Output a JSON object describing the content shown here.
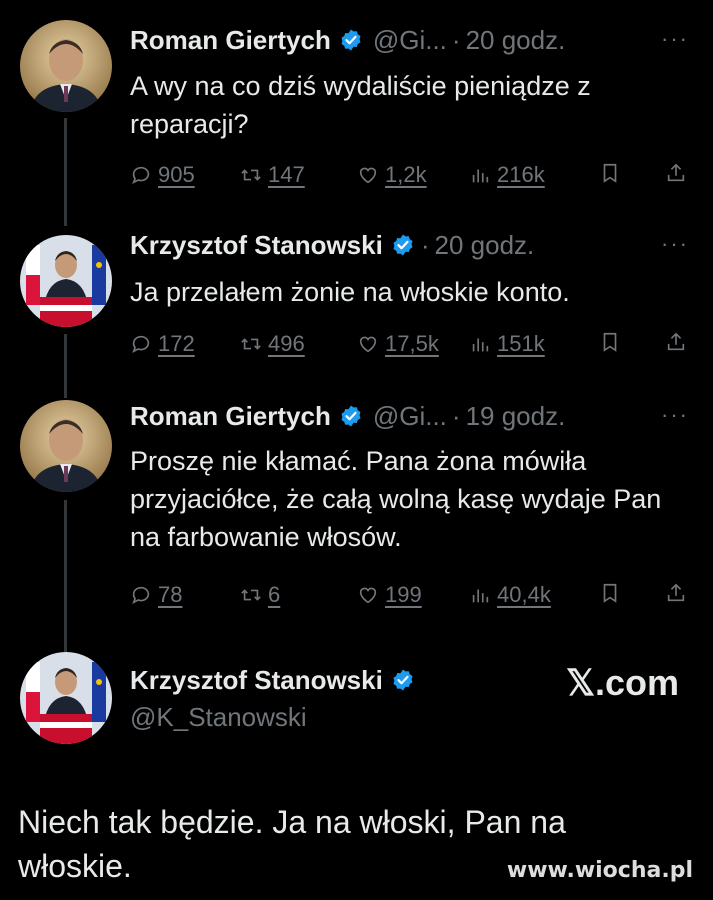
{
  "tweets": [
    {
      "name": "Roman Giertych",
      "handle": "@Gi...",
      "time": "20 godz.",
      "text": "A wy na co dziś wydaliście pieniądze z reparacji?",
      "replies": "905",
      "retweets": "147",
      "likes": "1,2k",
      "views": "216k"
    },
    {
      "name": "Krzysztof Stanowski",
      "handle": "",
      "time": "20 godz.",
      "text": "Ja przelałem żonie na włoskie konto.",
      "replies": "172",
      "retweets": "496",
      "likes": "17,5k",
      "views": "151k"
    },
    {
      "name": "Roman Giertych",
      "handle": "@Gi...",
      "time": "19 godz.",
      "text": "Proszę nie kłamać. Pana żona mówiła przyjaciółce, że całą wolną kasę wydaje Pan na farbowanie włosów.",
      "replies": "78",
      "retweets": "6",
      "likes": "199",
      "views": "40,4k"
    }
  ],
  "main": {
    "name": "Krzysztof Stanowski",
    "handle": "@K_Stanowski",
    "logo": "𝕏.com",
    "text": "Niech tak będzie. Ja na włoski, Pan na włoskie."
  },
  "dot": "·",
  "more": "···",
  "watermark": "www.wiocha.pl",
  "colors": {
    "background": "#000000",
    "text": "#e7e9ea",
    "muted": "#71767b",
    "verified": "#1d9bf0"
  }
}
